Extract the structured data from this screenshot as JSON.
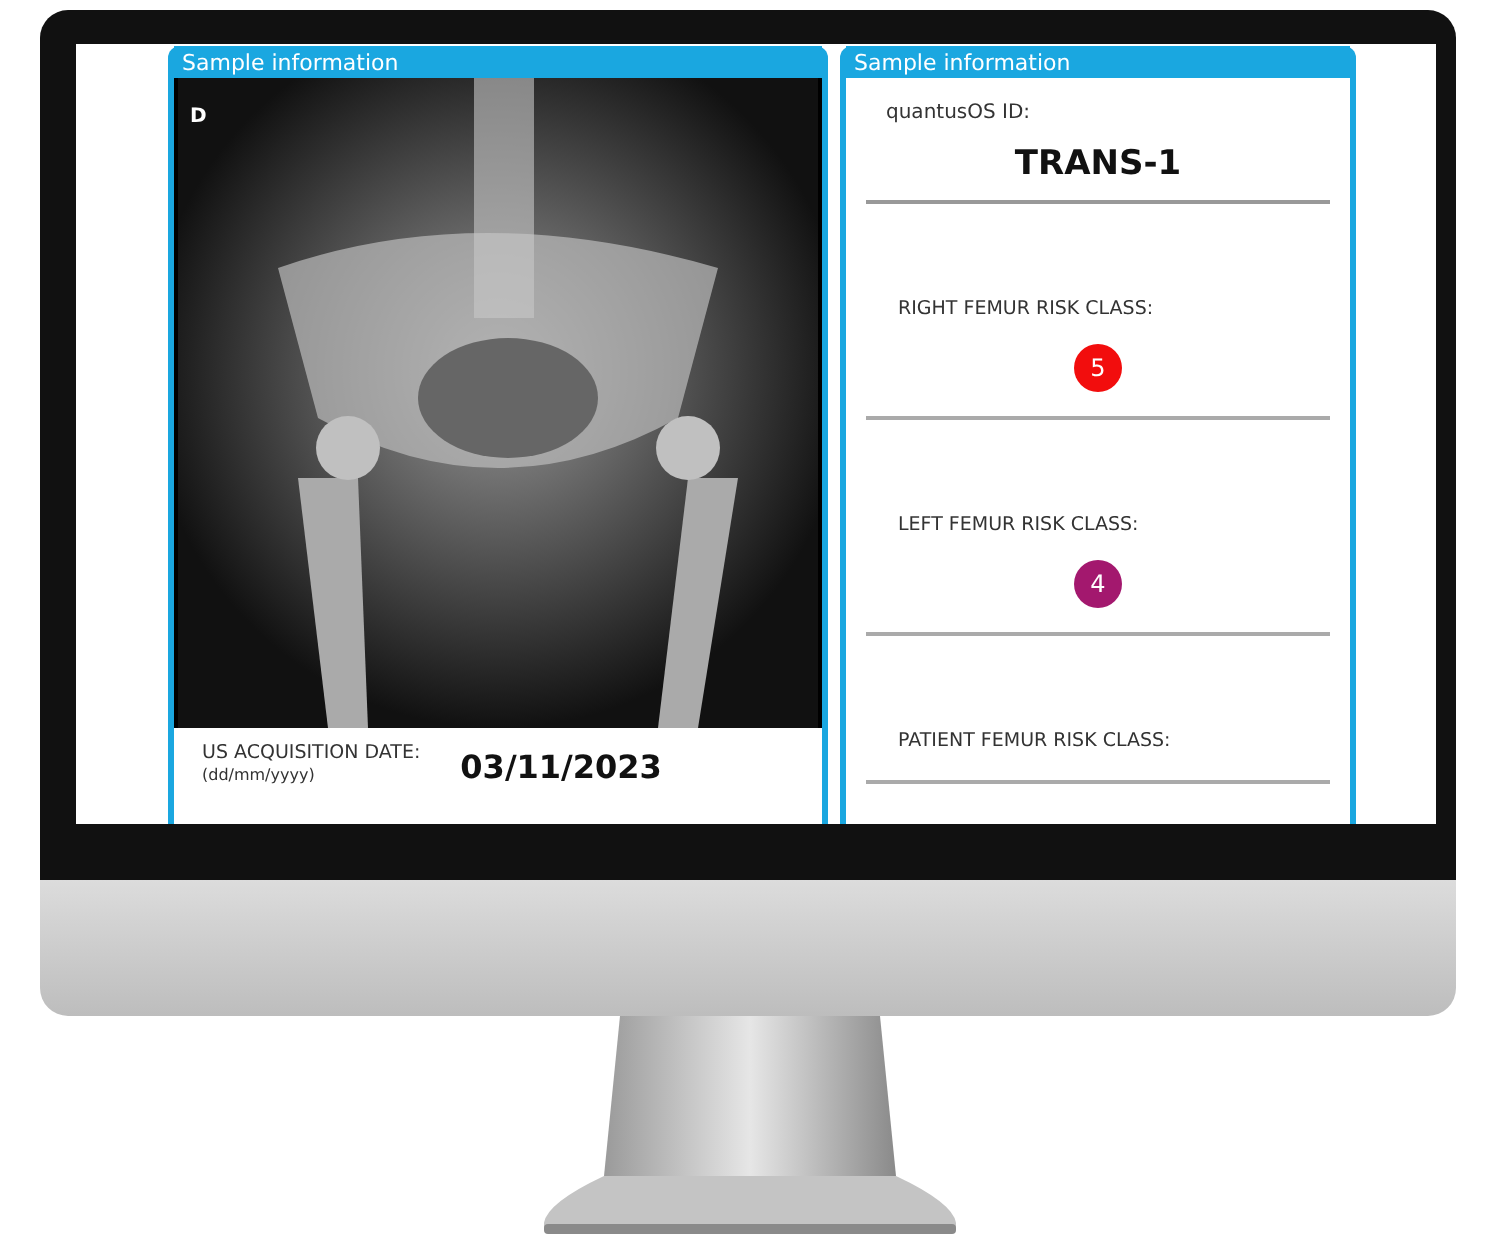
{
  "panels": [
    {
      "kind": "image",
      "header": "Sample information",
      "image_label": "D",
      "date_label": "US ACQUISITION DATE:",
      "date_format": "(dd/mm/yyyy)",
      "date": "03/11/2023"
    },
    {
      "kind": "info",
      "header": "Sample information",
      "id_label": "quantusOS ID:",
      "id": "TRANS-1",
      "risks": [
        {
          "label": "RIGHT FEMUR RISK CLASS:",
          "value": "5",
          "color": "#f20d0d"
        },
        {
          "label": "LEFT FEMUR RISK CLASS:",
          "value": "4",
          "color": "#a3186e"
        },
        {
          "label": "PATIENT FEMUR RISK CLASS:"
        }
      ]
    }
  ]
}
